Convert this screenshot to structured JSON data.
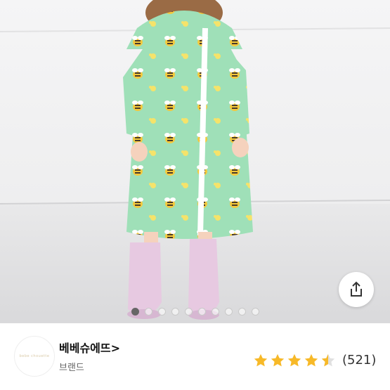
{
  "product": {
    "image_alt": "Child in mint green bee-print raincoat with pink rain boots",
    "carousel": {
      "total": 10,
      "active_index": 0
    },
    "share_icon": "share-icon"
  },
  "brand": {
    "name": "베베슈에뜨",
    "chevron": ">",
    "type_label": "브랜드",
    "logo_icon": "brand-logo"
  },
  "rating": {
    "value": 4.5,
    "count_text": "(521)",
    "star_color": "#f7b928"
  }
}
